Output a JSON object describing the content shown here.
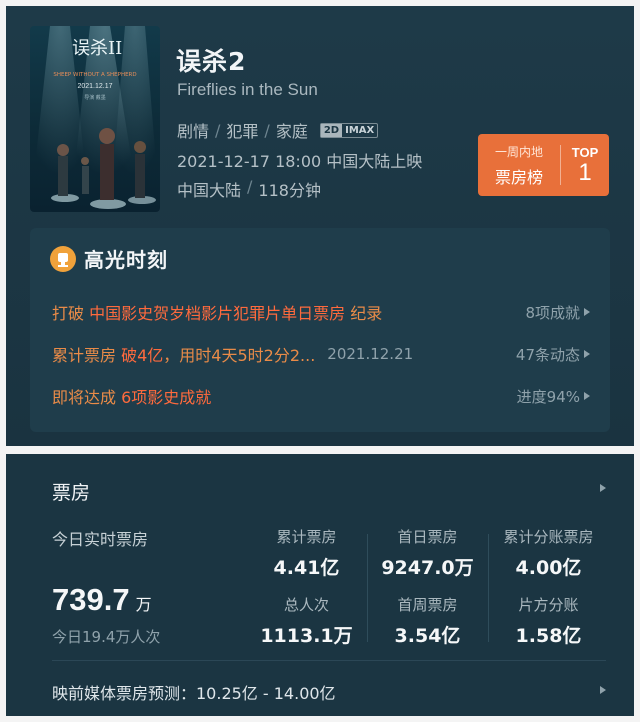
{
  "movie": {
    "title": "误杀2",
    "english_title": "Fireflies in the Sun",
    "genres": [
      "剧情",
      "犯罪",
      "家庭"
    ],
    "formats": [
      "2D",
      "IMAX"
    ],
    "release": "2021-12-17 18:00 中国大陆上映",
    "region": "中国大陆",
    "duration": "118分钟",
    "poster": {
      "title_text": "误杀II",
      "tagline": "SHEEP WITHOUT A SHEPHERD",
      "date": "2021.12.17",
      "credits": "导演 戴墨"
    }
  },
  "rank_badge": {
    "line1": "一周内地",
    "line2": "票房榜",
    "top_label": "TOP",
    "top_number": "1"
  },
  "highlights": {
    "title": "高光时刻",
    "rows": [
      {
        "prefix": "打破",
        "emph": "中国影史贺岁档影片犯罪片单日票房",
        "suffix": "纪录",
        "date": "",
        "right": "8项成就"
      },
      {
        "prefix": "累计票房",
        "emph": "破4亿",
        "suffix": "，用时4天5时2分2...",
        "date": "2021.12.21",
        "right": "47条动态"
      },
      {
        "prefix": "即将达成",
        "emph": "6项影史成就",
        "suffix": "",
        "date": "",
        "right": "进度94%"
      }
    ]
  },
  "box_office": {
    "title": "票房",
    "today_label": "今日实时票房",
    "today_value": "739.7",
    "today_unit": "万",
    "today_sub": "今日19.4万人次",
    "stats": [
      {
        "label": "累计票房",
        "value": "4.41亿"
      },
      {
        "label": "首日票房",
        "value": "9247.0万"
      },
      {
        "label": "累计分账票房",
        "value": "4.00亿"
      },
      {
        "label": "总人次",
        "value": "1113.1万"
      },
      {
        "label": "首周票房",
        "value": "3.54亿"
      },
      {
        "label": "片方分账",
        "value": "1.58亿"
      }
    ],
    "forecast": "映前媒体票房预测：10.25亿 - 14.00亿"
  },
  "colors": {
    "accent": "#e8703a",
    "emphasis": "#ff6a3d",
    "card": "#1e3a48"
  }
}
